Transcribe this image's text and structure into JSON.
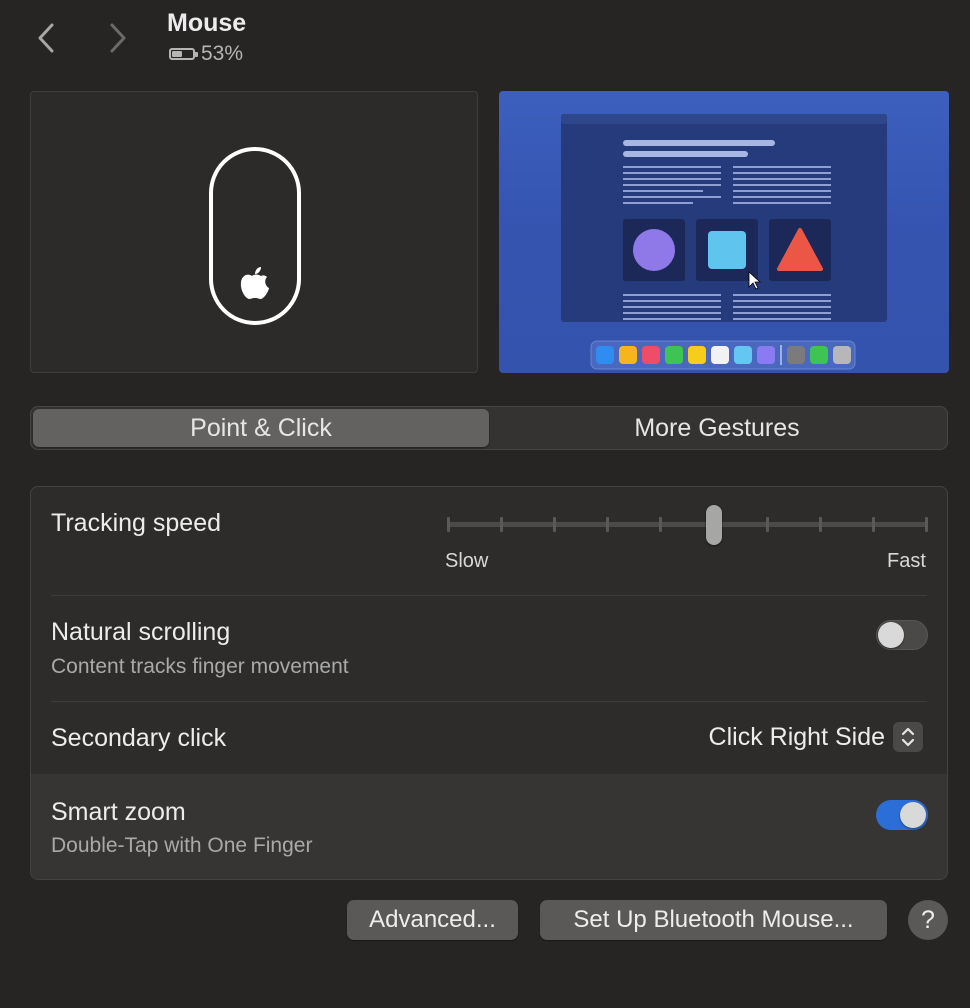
{
  "header": {
    "title": "Mouse",
    "battery_percent": "53%",
    "battery_level": 0.53
  },
  "segments": [
    {
      "label": "Point & Click",
      "active": true
    },
    {
      "label": "More Gestures",
      "active": false
    }
  ],
  "settings": {
    "tracking_speed": {
      "label": "Tracking speed",
      "min_label": "Slow",
      "max_label": "Fast",
      "ticks": 10,
      "value_tick": 6
    },
    "natural_scrolling": {
      "label": "Natural scrolling",
      "description": "Content tracks finger movement",
      "enabled": false
    },
    "secondary_click": {
      "label": "Secondary click",
      "value": "Click Right Side"
    },
    "smart_zoom": {
      "label": "Smart zoom",
      "description": "Double-Tap with One Finger",
      "enabled": true
    }
  },
  "buttons": {
    "advanced": "Advanced...",
    "setup": "Set Up Bluetooth Mouse...",
    "help": "?"
  },
  "colors": {
    "accent": "#2c6ed8",
    "preview_bg": "#3a5bb8"
  },
  "icons": {
    "back": "chevron-left-icon",
    "forward": "chevron-right-icon",
    "battery": "battery-icon",
    "mouse": "magic-mouse-icon",
    "apple": "apple-logo-icon"
  }
}
